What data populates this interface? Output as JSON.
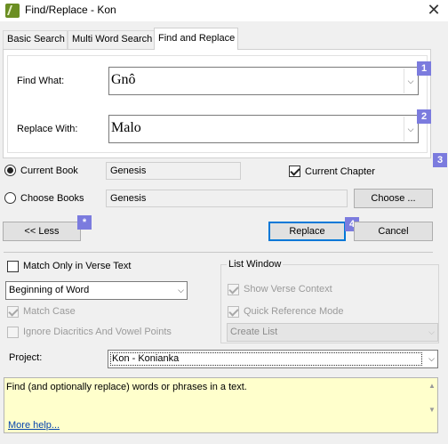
{
  "window": {
    "title": "Find/Replace - Kon",
    "close_glyph": "✕"
  },
  "tabs": [
    {
      "label": "Basic Search",
      "active": false
    },
    {
      "label": "Multi Word Search",
      "active": false
    },
    {
      "label": "Find and Replace",
      "active": true
    }
  ],
  "find": {
    "label": "Find What:",
    "value": "Gnô",
    "badge": "1"
  },
  "replace": {
    "label": "Replace With:",
    "value": "Malo",
    "badge": "2"
  },
  "scope": {
    "badge": "3",
    "current_book": {
      "label": "Current Book",
      "value": "Genesis",
      "selected": true
    },
    "choose_books": {
      "label": "Choose Books",
      "value": "Genesis",
      "selected": false,
      "button_label": "Choose ..."
    },
    "current_chapter": {
      "label": "Current Chapter",
      "checked": true
    }
  },
  "actions": {
    "less_label": "<< Less",
    "less_badge": "*",
    "replace_label": "Replace",
    "replace_badge": "4",
    "cancel_label": "Cancel"
  },
  "options": {
    "match_verse_text": {
      "label": "Match Only in Verse Text",
      "checked": false
    },
    "word_position": {
      "value": "Beginning of Word"
    },
    "match_case": {
      "label": "Match Case",
      "checked": true,
      "enabled": false
    },
    "ignore_diacritics": {
      "label": "Ignore Diacritics And Vowel Points",
      "checked": false,
      "enabled": false
    }
  },
  "list_window": {
    "title": "List Window",
    "show_verse_context": {
      "label": "Show Verse Context",
      "checked": true,
      "enabled": false
    },
    "quick_reference": {
      "label": "Quick Reference Mode",
      "checked": true,
      "enabled": false
    },
    "create_list": {
      "value": "Create List",
      "enabled": false
    }
  },
  "project": {
    "label": "Project:",
    "value": "Kon -  Konianka"
  },
  "help": {
    "text": "Find (and optionally replace) words or phrases in a text.",
    "link_label": "More help..."
  },
  "colors": {
    "badge": "#7b7bde",
    "help_background": "#ffffcc",
    "default_button_border": "#0078d7",
    "link": "#0645ad"
  }
}
